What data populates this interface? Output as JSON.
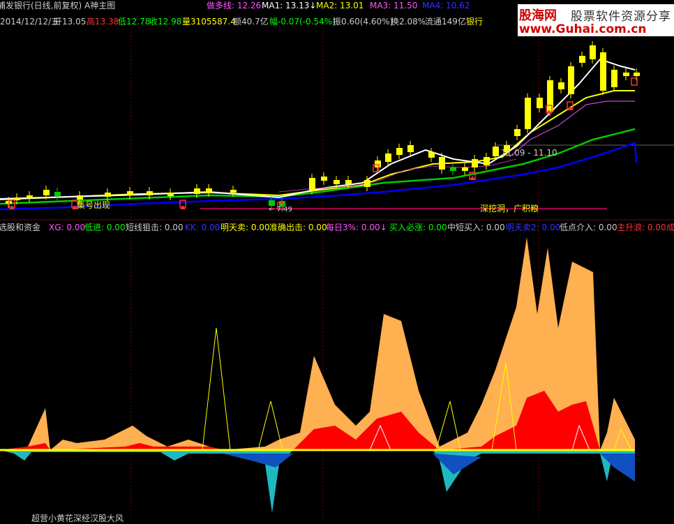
{
  "header": {
    "title": "浦发银行(日线,前复权) A神主图",
    "ma_labels": [
      {
        "label": "做多线: 12.26",
        "color": "#ff55ff"
      },
      {
        "label": "MA1: 13.13↓",
        "color": "#ffffff"
      },
      {
        "label": "MA2: 13.01",
        "color": "#ffff00"
      },
      {
        "label": "MA3: 11.50",
        "color": "#ff55ff"
      },
      {
        "label": "MA4: 10.62",
        "color": "#3333ff"
      }
    ]
  },
  "quote": {
    "date": "2014/12/12/五",
    "open": "开13.05",
    "high": "高13.38",
    "low": "低12.78",
    "close": "收12.98",
    "volume": "量3105587.4",
    "amount": "额40.7亿",
    "change": "幅-0.07(-0.54%)",
    "amplitude": "振0.60(4.60%)",
    "turnover": "换2.08%",
    "float_cap": "流通149亿",
    "sector": "银行"
  },
  "annotations": {
    "date_range": "11.09 - 11.10",
    "deep_dig": "深挖洞，广积粮",
    "signal": "集号出现",
    "low_price": "← 7.49"
  },
  "indicator": {
    "name": "选股和资金",
    "items": [
      {
        "label": "XG: 0.00",
        "color": "#ff55ff"
      },
      {
        "label": "低进: 0.00",
        "color": "#00ff00"
      },
      {
        "label": "短线狙击: 0.00",
        "color": "#cccccc"
      },
      {
        "label": "KK: 0.00",
        "color": "#3333ff"
      },
      {
        "label": "明天卖: 0.00",
        "color": "#ffff00"
      },
      {
        "label": "准确出击: 0.00",
        "color": "#ffff00"
      },
      {
        "label": "每日3%: 0.00↓",
        "color": "#ff55ff"
      },
      {
        "label": "买入必涨: 0.00",
        "color": "#00ff00"
      },
      {
        "label": "中短买入: 0.00",
        "color": "#cccccc"
      },
      {
        "label": "明天卖2: 0.00",
        "color": "#3333ff"
      },
      {
        "label": "低点介入: 0.00",
        "color": "#cccccc"
      },
      {
        "label": "主升浪: 0.00",
        "color": "#ff3333"
      },
      {
        "label": "成",
        "color": "#ff3333"
      }
    ]
  },
  "watermark": {
    "brand": "股海网",
    "slogan": "股票软件资源分享",
    "url": "www.Guhai.com.cn"
  },
  "footer": {
    "text": "超营小黄花深经汉股大风"
  }
}
